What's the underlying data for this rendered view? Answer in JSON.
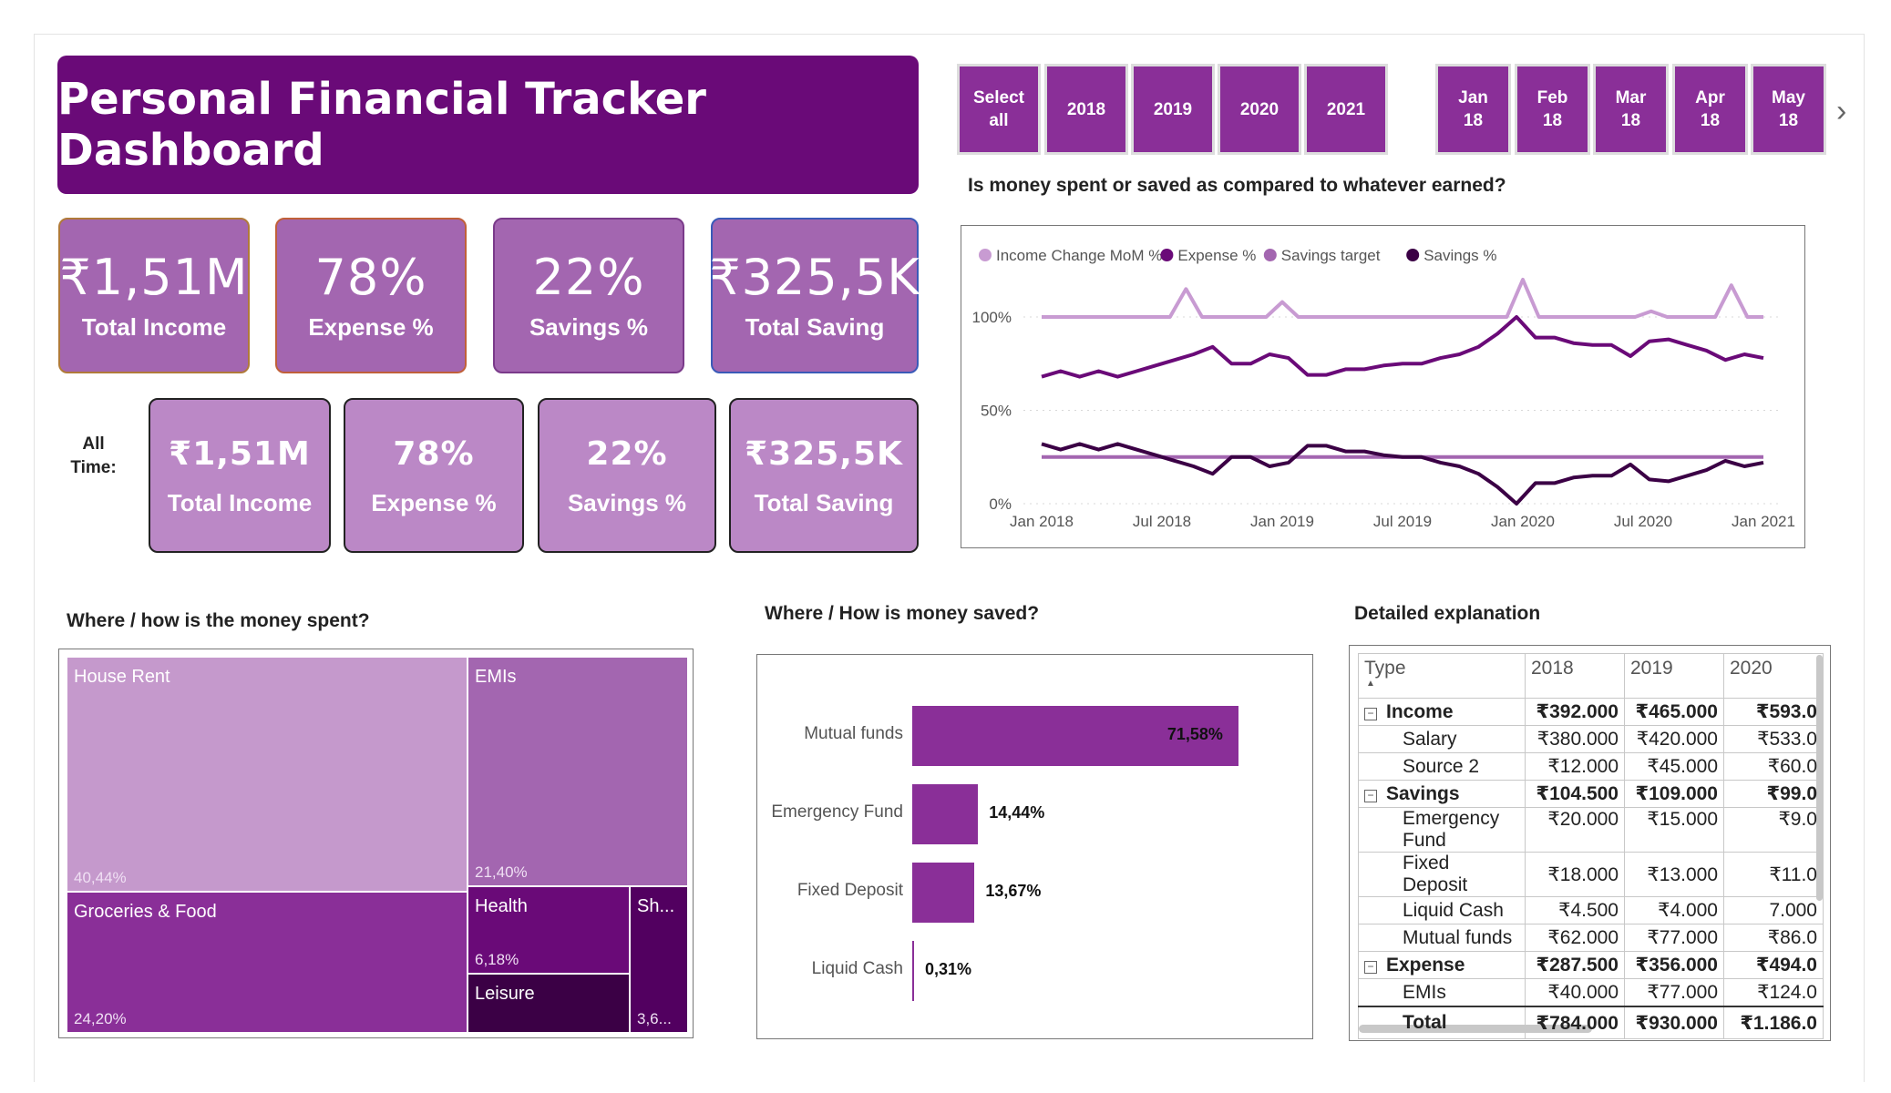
{
  "header": {
    "title": "Personal Financial Tracker Dashboard"
  },
  "colors": {
    "dark_purple": "#6a0a78",
    "kpi_purple": "#a366b0",
    "kpi_light": "#bb88c6",
    "accent": "#8a2f98"
  },
  "kpis_filtered": [
    {
      "value": "₹1,51M",
      "label": "Total Income"
    },
    {
      "value": "78%",
      "label": "Expense %"
    },
    {
      "value": "22%",
      "label": "Savings %"
    },
    {
      "value": "₹325,5K",
      "label": "Total Saving"
    }
  ],
  "all_time_label": "All\nTime:",
  "kpis_all_time": [
    {
      "value": "₹1,51M",
      "label": "Total Income"
    },
    {
      "value": "78%",
      "label": "Expense %"
    },
    {
      "value": "22%",
      "label": "Savings %"
    },
    {
      "value": "₹325,5K",
      "label": "Total Saving"
    }
  ],
  "year_slicer": [
    "Select\nall",
    "2018",
    "2019",
    "2020",
    "2021"
  ],
  "month_slicer": [
    "Jan\n18",
    "Feb\n18",
    "Mar\n18",
    "Apr\n18",
    "May\n18"
  ],
  "line_chart_heading": "Is money spent or saved as compared to whatever earned?",
  "spent_heading": "Where / how is the money spent?",
  "saved_heading": "Where / How is money saved?",
  "table_heading": "Detailed explanation",
  "chart_data": [
    {
      "type": "line",
      "title": "",
      "x_labels": [
        "Jan 2018",
        "Jul 2018",
        "Jan 2019",
        "Jul 2019",
        "Jan 2020",
        "Jul 2020",
        "Jan 2021"
      ],
      "y_ticks": [
        "0%",
        "50%",
        "100%"
      ],
      "ylim": [
        0,
        100
      ],
      "legend_position": "top-left",
      "series": [
        {
          "name": "Income Change MoM %",
          "color": "#c89bd2",
          "values": [
            100,
            100,
            100,
            100,
            100,
            100,
            100,
            100,
            100,
            115,
            100,
            100,
            100,
            100,
            100,
            108,
            100,
            100,
            100,
            100,
            100,
            100,
            100,
            100,
            100,
            100,
            100,
            100,
            100,
            100,
            120,
            100,
            100,
            100,
            100,
            100,
            100,
            100,
            103,
            100,
            100,
            100,
            100,
            117,
            100,
            100
          ]
        },
        {
          "name": "Expense %",
          "color": "#6a0a78",
          "values": [
            68,
            71,
            68,
            71,
            68,
            71,
            74,
            77,
            80,
            84,
            75,
            75,
            80,
            78,
            69,
            69,
            72,
            72,
            74,
            75,
            75,
            78,
            80,
            84,
            91,
            100,
            89,
            89,
            86,
            85,
            85,
            79,
            87,
            88,
            85,
            82,
            77,
            80,
            78
          ]
        },
        {
          "name": "Savings target",
          "color": "#a366b0",
          "values": [
            25,
            25,
            25,
            25,
            25,
            25,
            25,
            25,
            25,
            25,
            25,
            25,
            25,
            25,
            25,
            25,
            25,
            25,
            25,
            25,
            25,
            25,
            25,
            25,
            25,
            25,
            25,
            25,
            25,
            25,
            25,
            25,
            25,
            25,
            25,
            25,
            25,
            25,
            25
          ]
        },
        {
          "name": "Savings %",
          "color": "#3b0045",
          "values": [
            32,
            29,
            32,
            29,
            32,
            29,
            26,
            23,
            20,
            16,
            25,
            25,
            20,
            22,
            31,
            31,
            28,
            28,
            26,
            25,
            25,
            22,
            20,
            16,
            9,
            0,
            11,
            11,
            14,
            15,
            15,
            21,
            13,
            12,
            15,
            18,
            23,
            20,
            22
          ]
        }
      ]
    },
    {
      "type": "treemap",
      "items": [
        {
          "name": "House Rent",
          "percent": "40,44%",
          "color": "#c599cc"
        },
        {
          "name": "EMIs",
          "percent": "21,40%",
          "color": "#a366b0"
        },
        {
          "name": "Groceries & Food",
          "percent": "24,20%",
          "color": "#8a2f98"
        },
        {
          "name": "Health",
          "percent": "6,18%",
          "color": "#6a0a78"
        },
        {
          "name": "Leisure",
          "percent": "",
          "color": "#3b0045"
        },
        {
          "name": "Sh...",
          "percent": "3,6...",
          "color": "#520060"
        }
      ]
    },
    {
      "type": "bar",
      "orientation": "horizontal",
      "categories": [
        "Mutual funds",
        "Emergency Fund",
        "Fixed Deposit",
        "Liquid Cash"
      ],
      "values": [
        71.58,
        14.44,
        13.67,
        0.31
      ],
      "labels": [
        "71,58%",
        "14,44%",
        "13,67%",
        "0,31%"
      ],
      "xlim": [
        0,
        100
      ]
    }
  ],
  "matrix": {
    "headers": [
      "Type",
      "2018",
      "2019",
      "2020"
    ],
    "rows": [
      {
        "kind": "grp",
        "label": "Income",
        "v": [
          "₹392.000",
          "₹465.000",
          "₹593.0"
        ]
      },
      {
        "kind": "sub",
        "label": "Salary",
        "v": [
          "₹380.000",
          "₹420.000",
          "₹533.0"
        ]
      },
      {
        "kind": "sub",
        "label": "Source 2",
        "v": [
          "₹12.000",
          "₹45.000",
          "₹60.0"
        ]
      },
      {
        "kind": "grp",
        "label": "Savings",
        "v": [
          "₹104.500",
          "₹109.000",
          "₹99.0"
        ]
      },
      {
        "kind": "sub2",
        "label": "Emergency\nFund",
        "v": [
          "₹20.000",
          "₹15.000",
          "₹9.0"
        ]
      },
      {
        "kind": "sub",
        "label": "Fixed Deposit",
        "v": [
          "₹18.000",
          "₹13.000",
          "₹11.0"
        ]
      },
      {
        "kind": "sub",
        "label": "Liquid Cash",
        "v": [
          "₹4.500",
          "₹4.000",
          "7.000"
        ]
      },
      {
        "kind": "sub",
        "label": "Mutual funds",
        "v": [
          "₹62.000",
          "₹77.000",
          "₹86.0"
        ]
      },
      {
        "kind": "grp",
        "label": "Expense",
        "v": [
          "₹287.500",
          "₹356.000",
          "₹494.0"
        ]
      },
      {
        "kind": "sub",
        "label": "EMIs",
        "v": [
          "₹40.000",
          "₹77.000",
          "₹124.0"
        ]
      },
      {
        "kind": "total",
        "label": "Total",
        "v": [
          "₹784.000",
          "₹930.000",
          "₹1.186.0"
        ]
      }
    ]
  }
}
